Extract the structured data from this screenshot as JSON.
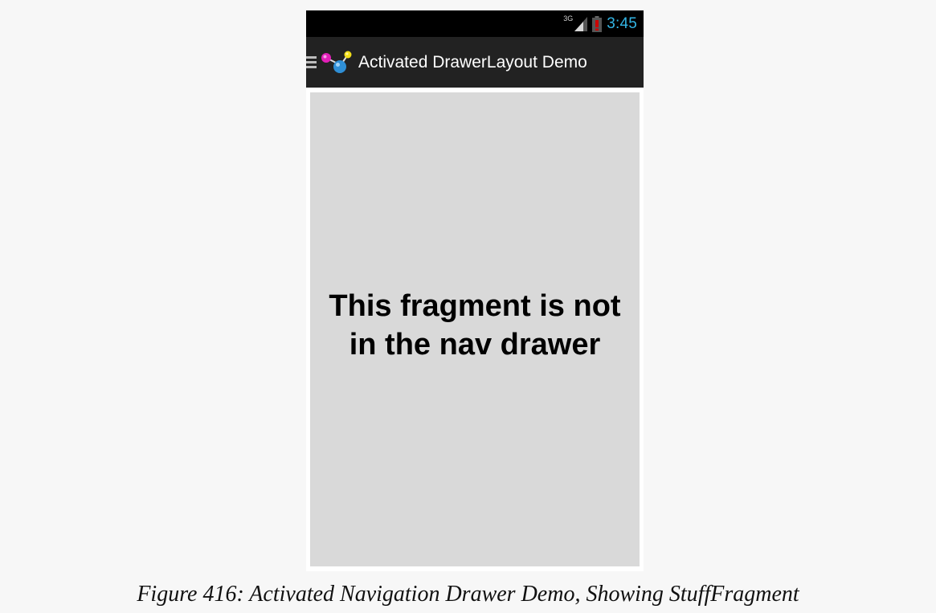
{
  "status_bar": {
    "network_type": "3G",
    "clock": "3:45",
    "clock_color": "#33b5e5",
    "battery_color": "#cc0000"
  },
  "action_bar": {
    "title": "Activated DrawerLayout Demo",
    "drawer_icon": "hamburger-icon",
    "app_icon": "molecule-app-icon"
  },
  "content": {
    "message": "This fragment is not in the nav drawer"
  },
  "caption": "Figure 416: Activated Navigation Drawer Demo, Showing StuffFragment"
}
